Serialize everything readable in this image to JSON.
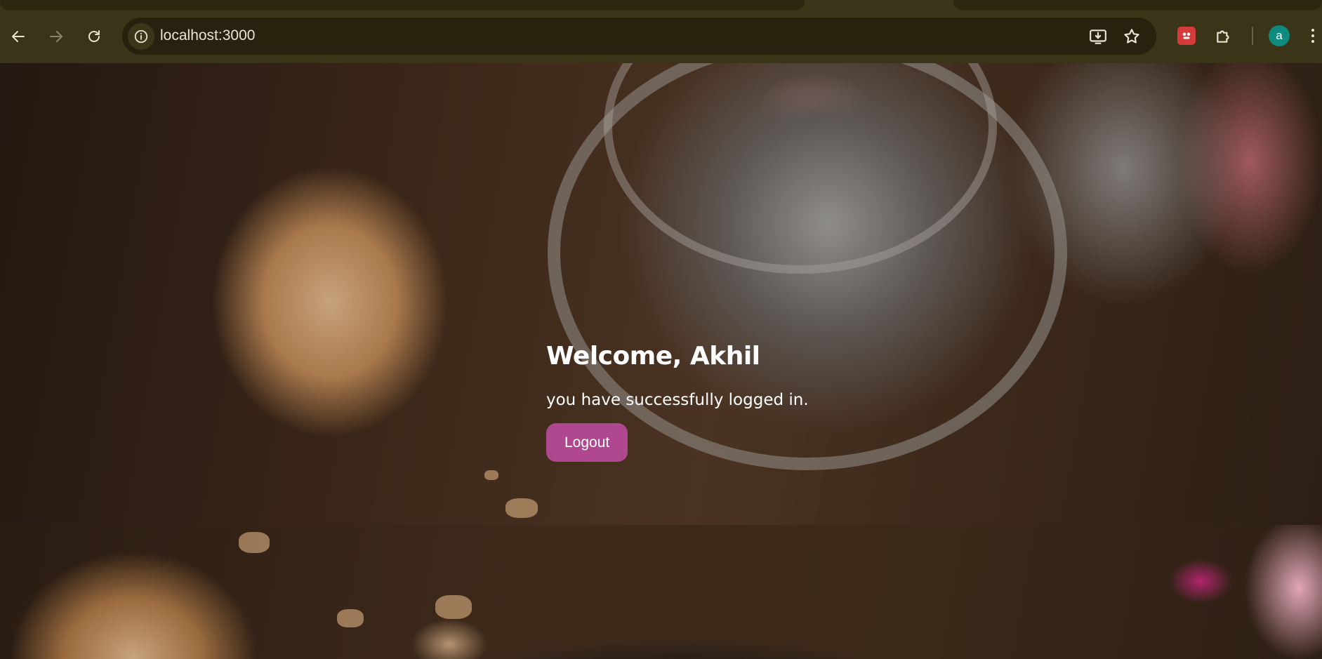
{
  "browser": {
    "url": "localhost:3000",
    "profile_initial": "a",
    "icons": {
      "back": "arrow-left-icon",
      "forward": "arrow-right-icon",
      "reload": "reload-icon",
      "site_info": "info-icon",
      "install": "install-app-icon",
      "bookmark": "star-icon",
      "extension": "extension-icon",
      "extensions_menu": "puzzle-icon",
      "menu": "more-vert-icon"
    },
    "colors": {
      "chrome_bg": "#3a3418",
      "omnibox_bg": "#27220d",
      "avatar_bg": "#0f8a7e"
    }
  },
  "page": {
    "welcome_title": "Welcome, Akhil",
    "welcome_message": "you have successfully logged in.",
    "logout_label": "Logout",
    "colors": {
      "logout_button": "#b0488f",
      "text": "#ffffff"
    }
  }
}
